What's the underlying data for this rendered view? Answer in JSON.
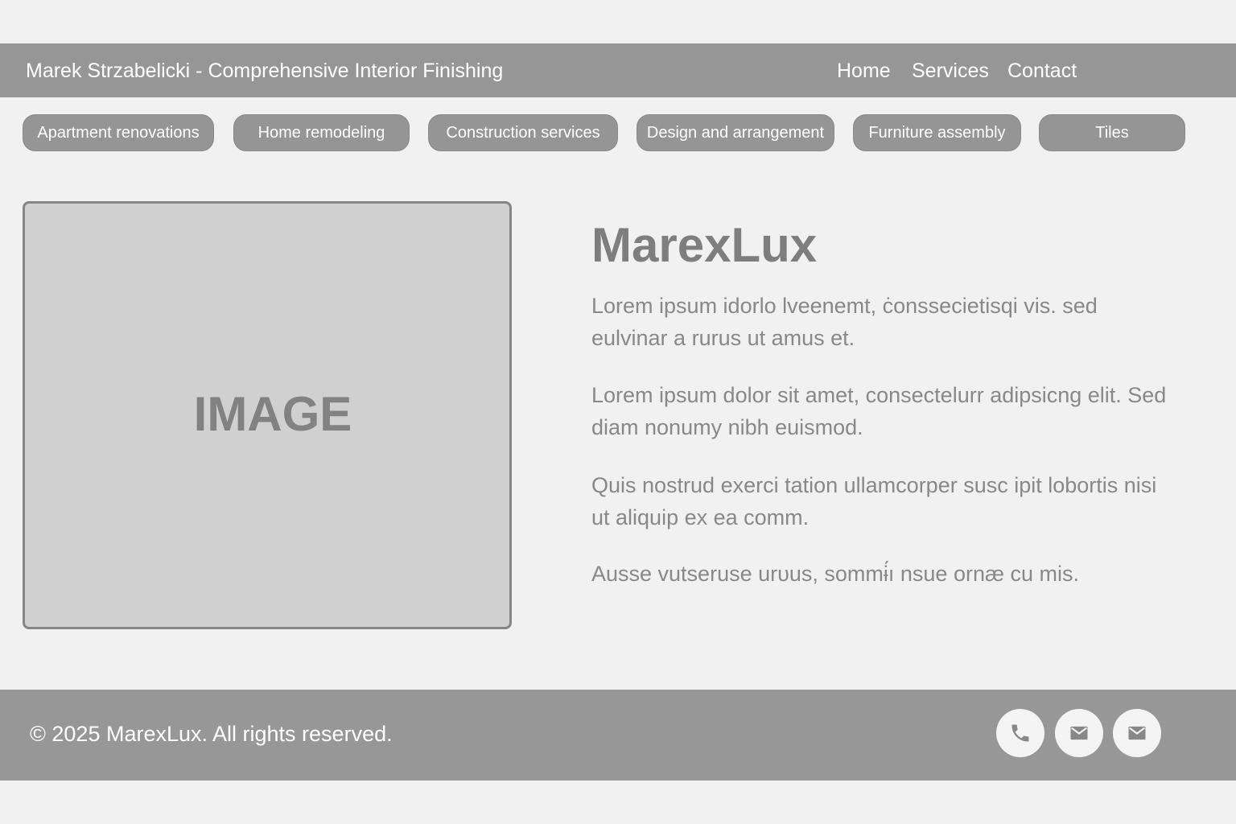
{
  "header": {
    "site_title": "Marek Strzabelicki - Comprehensive  Interior Finishing",
    "nav": {
      "home": "Home",
      "services": "Services",
      "contact": "Contact"
    }
  },
  "categories": [
    "Apartment renovations",
    "Home remodeling",
    "Construction services",
    "Design and arrangement",
    "Furniture assembly",
    "Tiles"
  ],
  "hero": {
    "image_label": "IMAGE",
    "brand": "MarexLux",
    "paragraphs": [
      "Lorem ipsum idorlo lveenemt, ċonssecietisqi vis. sed eulvinar a rurus ut amus et.",
      "Lorem ipsum dolor sit amet, consectelurr adipsicng elit. Sed diam nonumy nibh euismod.",
      "Quis nostrud exerci tation ullamcorper susc ipit lobortis nisi ut aliquip ex ea comm.",
      "Ausse vutseruse urυus, sommɨ́ı nsue  ornæ cu mis."
    ]
  },
  "footer": {
    "copyright": "© 2025 MarexLux. All rights reserved.",
    "icons": [
      "phone-icon",
      "mail-icon",
      "mail-icon"
    ]
  },
  "colors": {
    "bar": "#969696",
    "chip": "#959595",
    "page_bg": "#f1f1f1",
    "image_bg": "#d0d0d0",
    "text_gray": "#888888"
  }
}
